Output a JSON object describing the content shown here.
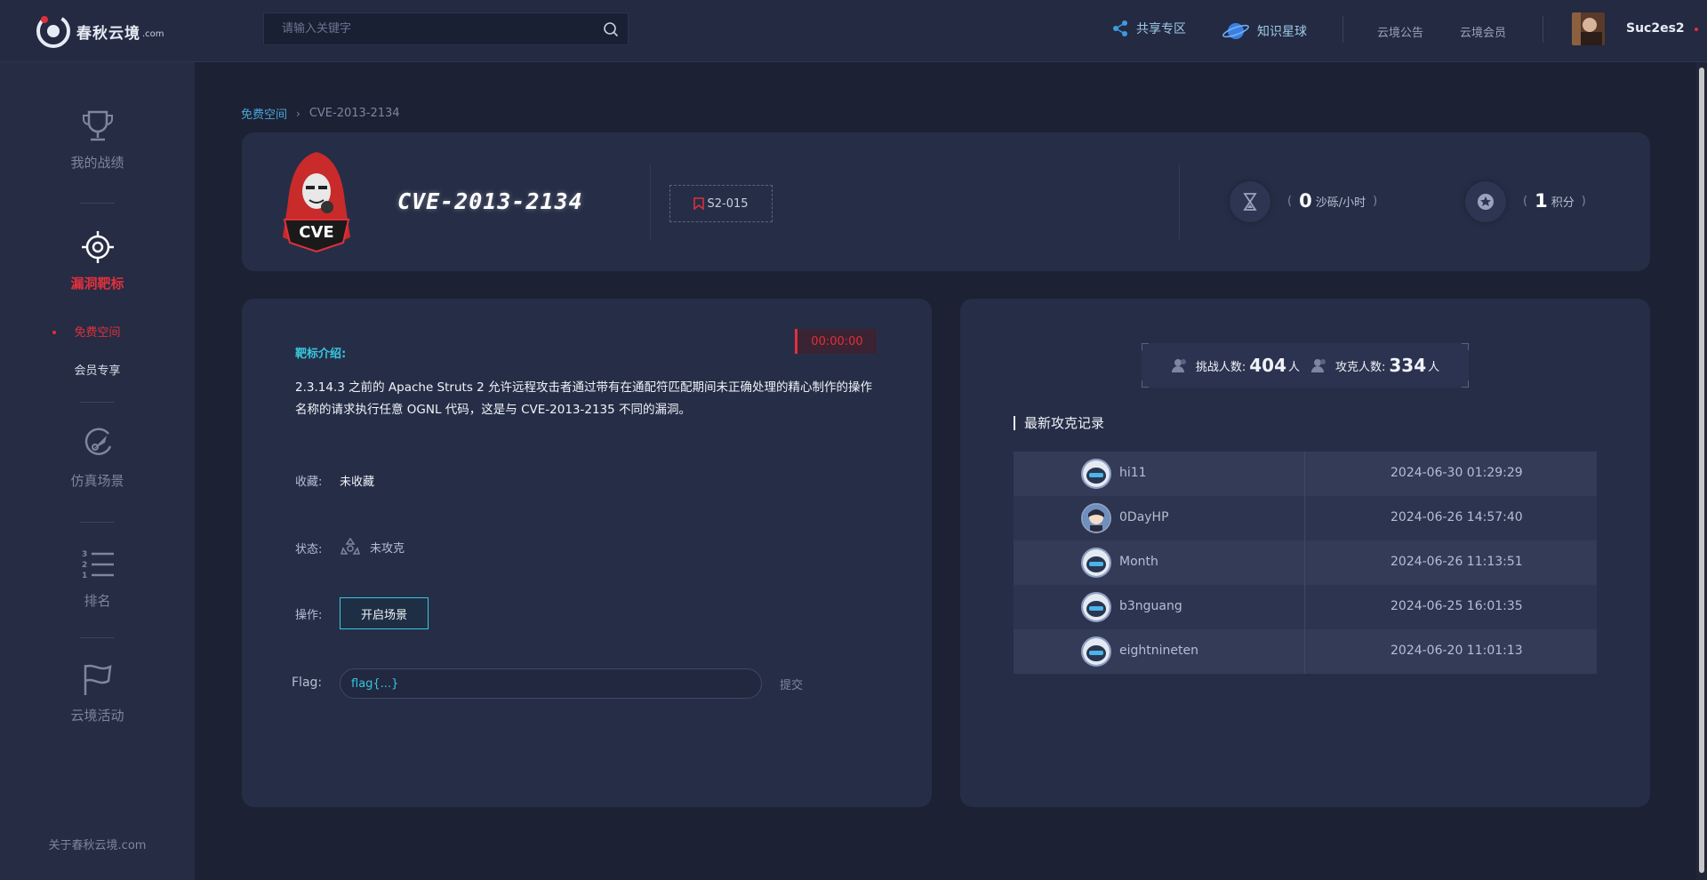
{
  "header": {
    "logo_text": "春秋云境",
    "logo_sub": ".com",
    "search_placeholder": "请输入关键字",
    "nav_share": "共享专区",
    "nav_knowledge": "知识星球",
    "nav_notice": "云境公告",
    "nav_member": "云境会员",
    "username": "Suc2es2"
  },
  "sidebar": {
    "items": [
      {
        "label": "我的战绩",
        "icon": "trophy-icon"
      },
      {
        "label": "漏洞靶标",
        "icon": "target-icon"
      },
      {
        "label": "仿真场景",
        "icon": "rocket-icon"
      },
      {
        "label": "排名",
        "icon": "ranking-list-icon"
      },
      {
        "label": "云境活动",
        "icon": "flag-icon"
      }
    ],
    "sub_items": [
      "免费空间",
      "会员专享"
    ],
    "footer": "关于春秋云境.com"
  },
  "breadcrumb": {
    "parent": "免费空间",
    "current": "CVE-2013-2134"
  },
  "target": {
    "title": "CVE-2013-2134",
    "tag": "S2-015",
    "sand_value": "0",
    "sand_unit": "沙砾/小时",
    "score_value": "1",
    "score_unit": "积分"
  },
  "detail": {
    "intro_label": "靶标介绍:",
    "timer": "00:00:00",
    "intro_text": "2.3.14.3 之前的 Apache Struts 2 允许远程攻击者通过带有在通配符匹配期间未正确处理的精心制作的操作名称的请求执行任意 OGNL 代码，这是与 CVE-2013-2135 不同的漏洞。",
    "favorite_label": "收藏:",
    "favorite_value": "未收藏",
    "status_label": "状态:",
    "status_value": "未攻克",
    "action_label": "操作:",
    "action_button": "开启场景",
    "flag_label": "Flag:",
    "flag_value": "flag{...}",
    "submit": "提交"
  },
  "stats": {
    "challengers_label": "挑战人数:",
    "challengers": "404",
    "conquerors_label": "攻克人数:",
    "conquerors": "334",
    "unit": "人"
  },
  "records": {
    "title": "最新攻克记录",
    "rows": [
      {
        "name": "hi11",
        "time": "2024-06-30 01:29:29"
      },
      {
        "name": "0DayHP",
        "time": "2024-06-26 14:57:40"
      },
      {
        "name": "Month",
        "time": "2024-06-26 11:13:51"
      },
      {
        "name": "b3nguang",
        "time": "2024-06-25 16:01:35"
      },
      {
        "name": "eightnineten",
        "time": "2024-06-20 11:01:13"
      }
    ]
  },
  "colors": {
    "accent_red": "#e0303d",
    "accent_cyan": "#37c7de",
    "panel": "#262e47",
    "background": "#1c2133"
  }
}
